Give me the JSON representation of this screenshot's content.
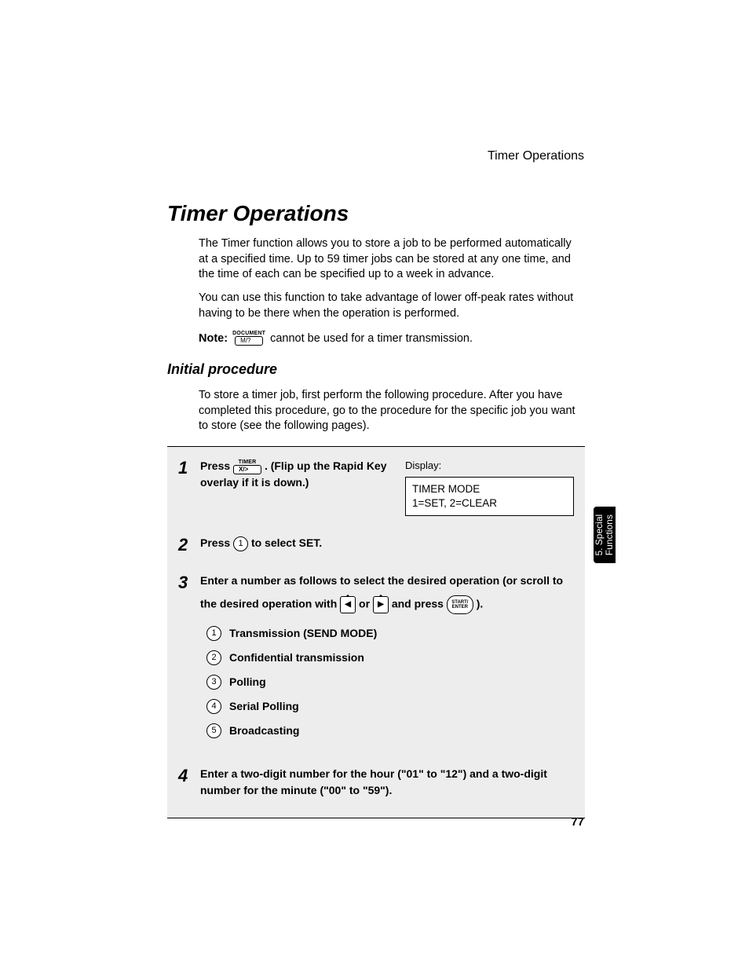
{
  "header": {
    "running_title": "Timer Operations"
  },
  "title": "Timer Operations",
  "intro": {
    "p1": "The Timer function allows you to store a job to be performed automatically at a specified time. Up to 59 timer jobs can be stored at any one time, and the time of each can be specified up to a week in advance.",
    "p2": "You can use this function to take advantage of lower off-peak rates without having to be there when the operation is performed."
  },
  "note": {
    "label": "Note:",
    "key_top": "DOCUMENT",
    "key_label": "M/?",
    "text": " cannot be used for a timer transmission."
  },
  "section": {
    "subhead": "Initial procedure",
    "p3": "To store a timer job, first perform the following procedure. After you have completed this procedure, go to the procedure for the specific job you want to store (see the following pages)."
  },
  "steps": {
    "s1": {
      "num": "1",
      "press": "Press ",
      "key_top": "TIMER",
      "key_label": "X/>",
      "rest": " . (Flip up the Rapid Key overlay if it is down.)",
      "display_label": "Display:",
      "display_line1": "TIMER MODE",
      "display_line2": "1=SET, 2=CLEAR"
    },
    "s2": {
      "num": "2",
      "press": "Press ",
      "circ": "1",
      "rest": " to select SET."
    },
    "s3": {
      "num": "3",
      "line_a": "Enter a number as follows to select the desired operation (or scroll to",
      "line_b_pre": "the desired operation with ",
      "or": " or ",
      "and_press": " and press ",
      "start_top": "START/",
      "start_bot": "ENTER",
      "close": ").",
      "options": [
        {
          "n": "1",
          "label": "Transmission (SEND MODE)"
        },
        {
          "n": "2",
          "label": "Confidential transmission"
        },
        {
          "n": "3",
          "label": "Polling"
        },
        {
          "n": "4",
          "label": "Serial Polling"
        },
        {
          "n": "5",
          "label": "Broadcasting"
        }
      ]
    },
    "s4": {
      "num": "4",
      "text": "Enter a two-digit number for the hour (\"01\" to \"12\") and a two-digit number for the minute (\"00\" to \"59\")."
    }
  },
  "side_tab": {
    "line1": "5. Special",
    "line2": "Functions"
  },
  "page_number": "77"
}
